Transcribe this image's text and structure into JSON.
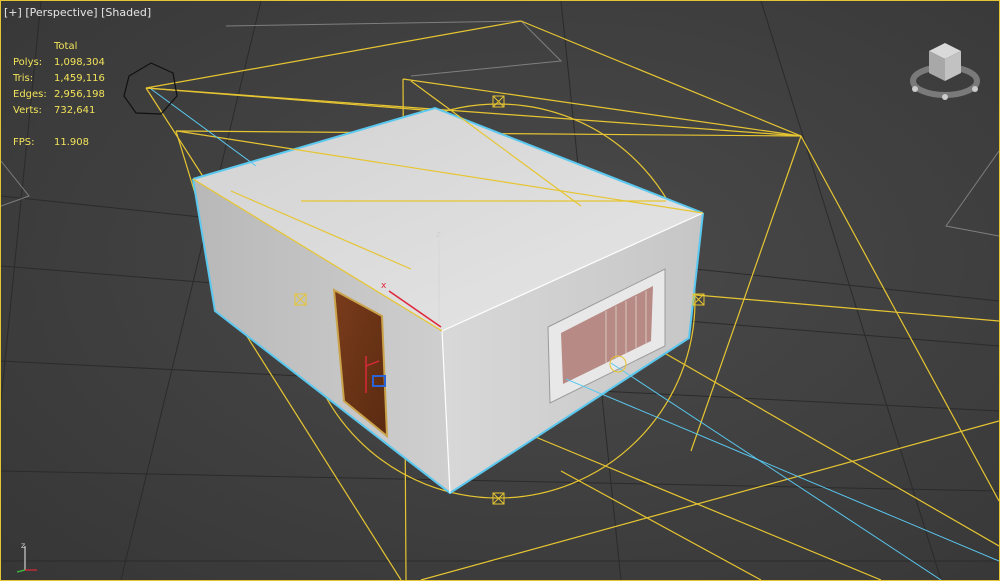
{
  "viewport": {
    "labels": [
      "[+]",
      "[Perspective]",
      "[Shaded]"
    ]
  },
  "stats": {
    "header": "Total",
    "rows": [
      {
        "label": "Polys:",
        "value": "1,098,304"
      },
      {
        "label": "Tris:",
        "value": "1,459,116"
      },
      {
        "label": "Edges:",
        "value": "2,956,198"
      },
      {
        "label": "Verts:",
        "value": "732,641"
      }
    ],
    "fps_label": "FPS:",
    "fps_value": "11.908"
  },
  "gizmo": {
    "axis_x": "x",
    "axis_z": "z"
  },
  "colors": {
    "selection": "#e6c532",
    "highlight": "#5ac8ef",
    "wall": "#c9c9c9",
    "roof": "#dcdcdc",
    "door": "#6e3518"
  }
}
